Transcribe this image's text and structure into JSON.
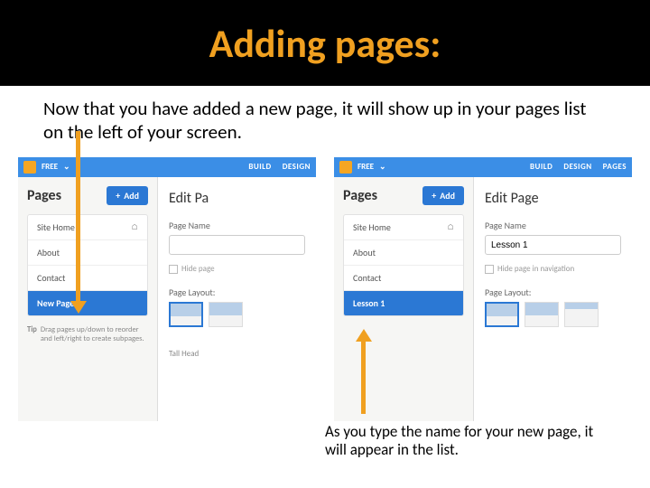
{
  "title": "Adding pages:",
  "intro": "Now that you have added a new page, it will show up in your pages list on the left of your screen.",
  "caption2": "As you type the name for your new page, it will appear in the list.",
  "app": {
    "free": "FREE",
    "tabs": {
      "build": "BUILD",
      "design": "DESIGN",
      "pages": "PAGES"
    },
    "pages_label": "Pages",
    "add_label": "Add",
    "edit_title_short": "Edit Pa",
    "edit_title": "Edit Page",
    "page_name_label": "Page Name",
    "hide_label_short": "Hide page",
    "hide_label": "Hide page in navigation",
    "layout_label_short": "Page Layout:",
    "layout_label": "Page Layout:",
    "tip_label": "Tip",
    "tip_text": "Drag pages up/down to reorder and left/right to create subpages.",
    "tall_head": "Tall Head"
  },
  "left": {
    "items": [
      "Site Home",
      "About",
      "Contact"
    ],
    "selected": "New Page",
    "input_value": ""
  },
  "right": {
    "items": [
      "Site Home",
      "About",
      "Contact"
    ],
    "selected": "Lesson 1",
    "input_value": "Lesson 1"
  }
}
